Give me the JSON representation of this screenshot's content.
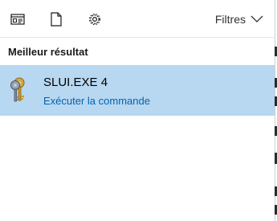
{
  "toolbar": {
    "icons": [
      {
        "name": "apps-icon"
      },
      {
        "name": "documents-icon"
      },
      {
        "name": "settings-gear-icon"
      }
    ],
    "filters_label": "Filtres",
    "filters_chevron_icon": "chevron-down-icon"
  },
  "best_match": {
    "section_title": "Meilleur résultat",
    "item": {
      "icon": "keys-icon",
      "title": "SLUI.EXE 4",
      "action": "Exécuter la commande"
    }
  },
  "colors": {
    "selection_bg": "#b8d7f0",
    "link": "#0063b1"
  }
}
